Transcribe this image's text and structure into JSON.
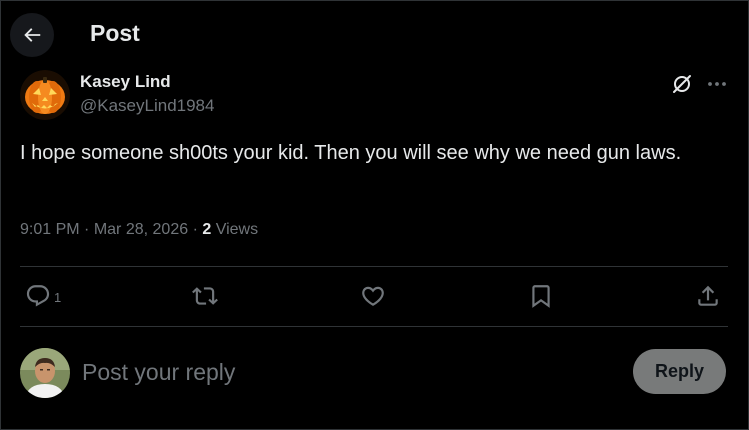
{
  "header": {
    "title": "Post",
    "back_icon": "arrow-left-icon"
  },
  "post": {
    "author": {
      "name": "Kasey Lind",
      "handle": "@KaseyLind1984",
      "avatar": "jack-o-lantern-avatar"
    },
    "text": "I hope someone sh00ts your kid. Then you will see why we need gun laws.",
    "time": "9:01 PM",
    "separator": "·",
    "date": "Mar 28, 2026",
    "views_count": "2",
    "views_label": "Views"
  },
  "actions": {
    "reply_count": "1",
    "icons": [
      "reply-icon",
      "repost-icon",
      "like-icon",
      "bookmark-icon",
      "share-icon"
    ]
  },
  "composer": {
    "placeholder": "Post your reply",
    "button_label": "Reply"
  },
  "colors": {
    "background": "#000000",
    "text": "#e7e9ea",
    "muted": "#71767b",
    "divider": "#2f3336",
    "reply_button": "#787a7a"
  }
}
